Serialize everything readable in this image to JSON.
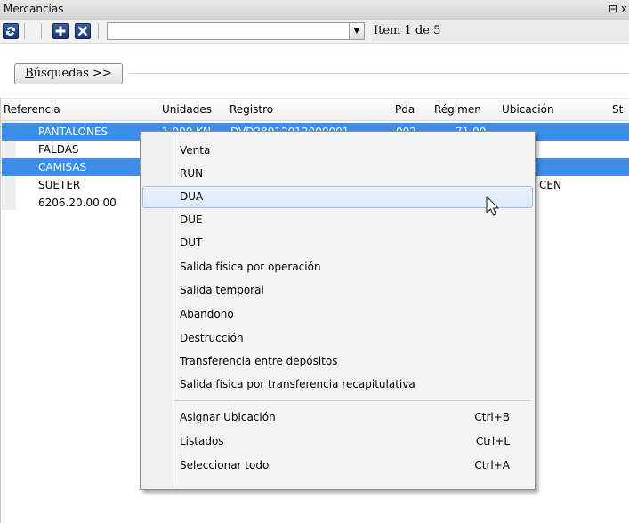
{
  "window": {
    "title": "Mercancías",
    "controls": "⊟ x"
  },
  "toolbar": {
    "refresh_icon": "refresh-icon",
    "add_icon": "plus-icon",
    "delete_icon": "x-icon",
    "combo_value": "",
    "item_counter": "Item 1 de 5"
  },
  "search": {
    "button_label": "Búsquedas >>",
    "underline_letter": "B"
  },
  "grid": {
    "columns": [
      "Referencia",
      "Unidades",
      "Registro",
      "Pda",
      "Régimen",
      "Ubicación",
      "St"
    ],
    "rows": [
      {
        "ref": "PANTALONES",
        "unidades": "1.000 KN",
        "registro": "DVD28012012000001",
        "pda": "002",
        "regimen": "71.00",
        "ubicacion": "",
        "selected": true
      },
      {
        "ref": "FALDAS",
        "unidades": "",
        "registro": "",
        "pda": "",
        "regimen": "",
        "ubicacion": "",
        "selected": false
      },
      {
        "ref": "CAMISAS",
        "unidades": "",
        "registro": "",
        "pda": "",
        "regimen": "",
        "ubicacion": "",
        "selected": true
      },
      {
        "ref": "SUETER",
        "unidades": "",
        "registro": "",
        "pda": "",
        "regimen": "",
        "ubicacion": "CEN",
        "selected": false
      },
      {
        "ref": "6206.20.00.00",
        "unidades": "",
        "registro": "",
        "pda": "",
        "regimen": "",
        "ubicacion": "",
        "selected": false
      }
    ]
  },
  "context_menu": {
    "items": [
      {
        "label": "Venta"
      },
      {
        "label": "RUN"
      },
      {
        "label": "DUA",
        "highlighted": true
      },
      {
        "label": "DUE"
      },
      {
        "label": "DUT"
      },
      {
        "label": "Salida física por operación"
      },
      {
        "label": "Salida temporal"
      },
      {
        "label": "Abandono"
      },
      {
        "label": "Destrucción"
      },
      {
        "label": "Transferencia entre depósitos"
      },
      {
        "label": "Salida física por transferencia recapitulativa"
      }
    ],
    "items2": [
      {
        "label": "Asignar Ubicación",
        "shortcut": "Ctrl+B"
      },
      {
        "label": "Listados",
        "shortcut": "Ctrl+L"
      },
      {
        "label": "Seleccionar todo",
        "shortcut": "Ctrl+A"
      }
    ]
  },
  "colors": {
    "selection": "#3d8ee8",
    "menu_highlight": "#dbe9f9",
    "toolbar_button": "#1b3473"
  }
}
